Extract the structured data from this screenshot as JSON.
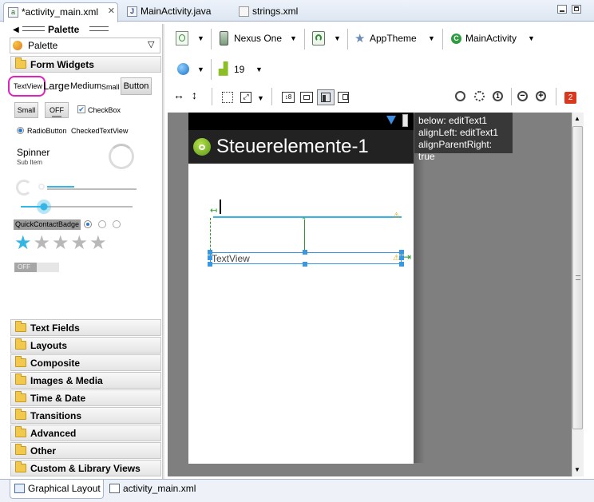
{
  "editor_tabs": [
    {
      "label": "*activity_main.xml",
      "icon": "xml-layout-icon",
      "active": true
    },
    {
      "label": "MainActivity.java",
      "icon": "java-file-icon",
      "active": false
    },
    {
      "label": "strings.xml",
      "icon": "xml-file-icon",
      "active": false
    }
  ],
  "palette": {
    "title": "Palette",
    "combo_label": "Palette",
    "form_widgets": "Form Widgets",
    "widgets": {
      "textview": "TextView",
      "large": "Large",
      "medium": "Medium",
      "small": "Small",
      "button": "Button",
      "small_button": "Small",
      "toggle_off": "OFF",
      "checkbox": "CheckBox",
      "radiobutton": "RadioButton",
      "checked_textview": "CheckedTextView",
      "spinner": "Spinner",
      "sub_item": "Sub Item",
      "quick_contact_badge": "QuickContactBadge",
      "switch_off": "OFF"
    },
    "sections": [
      "Text Fields",
      "Layouts",
      "Composite",
      "Images & Media",
      "Time & Date",
      "Transitions",
      "Advanced",
      "Other",
      "Custom & Library Views"
    ]
  },
  "toolbar": {
    "device": "Nexus One",
    "theme": "AppTheme",
    "activity": "MainActivity",
    "api_level": "19",
    "error_count": "2"
  },
  "canvas": {
    "app_title": "Steuerelemente-1",
    "textview_label": "TextView",
    "tooltip_lines": [
      "below: editText1",
      "alignLeft: editText1",
      "alignParentRight: true"
    ]
  },
  "bottom_tabs": [
    {
      "label": "Graphical Layout",
      "active": true
    },
    {
      "label": "activity_main.xml",
      "active": false
    }
  ],
  "colors": {
    "accent_blue": "#33b5e5",
    "selection_blue": "#3b98e0",
    "highlight_magenta": "#e020c0",
    "action_bar": "#222222",
    "error_red": "#d9381e"
  }
}
